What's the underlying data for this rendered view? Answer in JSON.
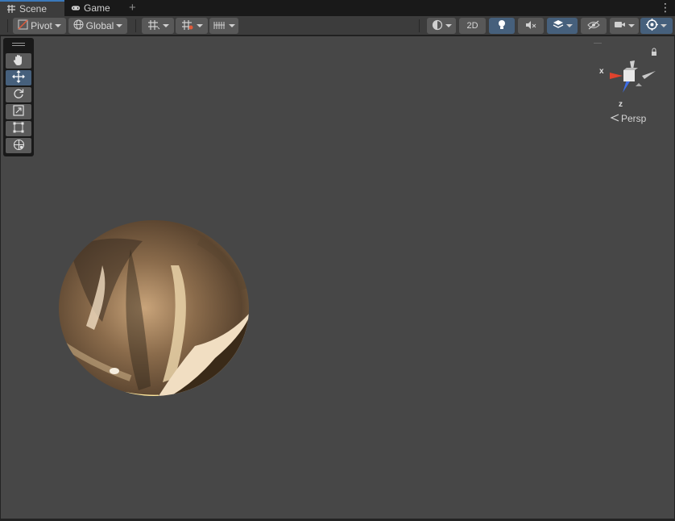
{
  "tabs": [
    {
      "label": "Scene",
      "icon": "grid-icon",
      "active": true
    },
    {
      "label": "Game",
      "icon": "gamepad-icon",
      "active": false
    }
  ],
  "add_tab_symbol": "+",
  "menu_symbol": "⋮",
  "toolbar": {
    "pivot_label": "Pivot",
    "global_label": "Global",
    "mode_2d_label": "2D"
  },
  "gizmo": {
    "x_label": "x",
    "z_label": "z",
    "projection_label": "Persp"
  },
  "tools": [
    {
      "name": "hand-tool",
      "icon": "hand-icon",
      "selected": false
    },
    {
      "name": "move-tool",
      "icon": "move-arrows-icon",
      "selected": true
    },
    {
      "name": "rotate-tool",
      "icon": "rotate-icon",
      "selected": false
    },
    {
      "name": "scale-tool",
      "icon": "scale-icon",
      "selected": false
    },
    {
      "name": "rect-tool",
      "icon": "rect-transform-icon",
      "selected": false
    },
    {
      "name": "transform-tool",
      "icon": "transform-icon",
      "selected": false
    }
  ],
  "colors": {
    "accent": "#3a79bb",
    "selected_button": "#46607c",
    "viewport_bg": "#474747",
    "axis_x": "#e0432d",
    "axis_z": "#3e6ee6"
  }
}
